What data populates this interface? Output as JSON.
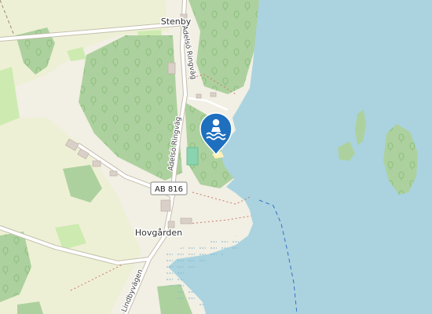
{
  "map": {
    "places": {
      "stenby": "Stenby",
      "hovgarden": "Hovgården"
    },
    "roads": {
      "adelso_north": "Adelsö Ringväg",
      "adelso_mid": "Adelsö Ringväg",
      "lindbyvagen": "Lindbyvägen",
      "shield": "AB 816"
    },
    "marker": {
      "icon": "swimming-icon",
      "color": "#1f6fbf"
    },
    "colors": {
      "water": "#aad3df",
      "forest": "#add19e",
      "grass": "#cdebb0",
      "land": "#f2efe4",
      "road": "#ffffff",
      "road_casing": "#c5bfae"
    }
  }
}
